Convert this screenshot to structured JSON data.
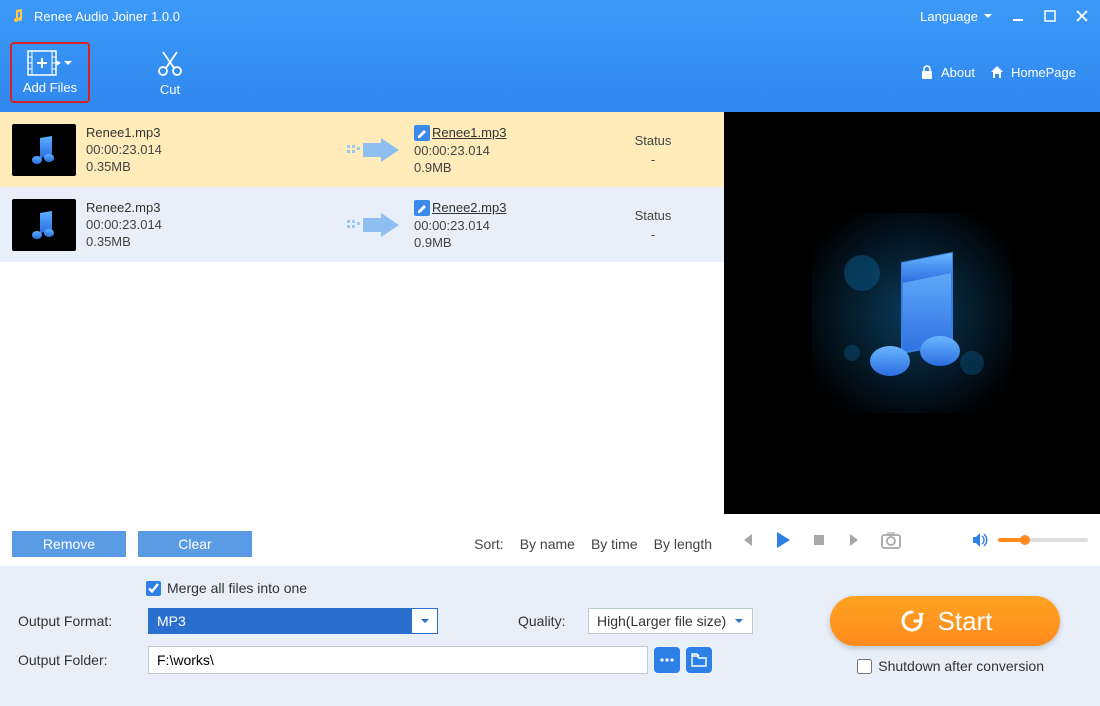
{
  "titlebar": {
    "title": "Renee Audio Joiner 1.0.0",
    "language_label": "Language"
  },
  "toolbar": {
    "add_files": "Add Files",
    "cut": "Cut",
    "about": "About",
    "homepage": "HomePage"
  },
  "files": [
    {
      "name": "Renee1.mp3",
      "duration": "00:00:23.014",
      "size": "0.35MB",
      "out_name": "Renee1.mp3",
      "out_duration": "00:00:23.014",
      "out_size": "0.9MB",
      "status_label": "Status",
      "status_value": "-",
      "selected": true
    },
    {
      "name": "Renee2.mp3",
      "duration": "00:00:23.014",
      "size": "0.35MB",
      "out_name": "Renee2.mp3",
      "out_duration": "00:00:23.014",
      "out_size": "0.9MB",
      "status_label": "Status",
      "status_value": "-",
      "selected": false
    }
  ],
  "listctrl": {
    "remove": "Remove",
    "clear": "Clear",
    "sort_label": "Sort:",
    "by_name": "By name",
    "by_time": "By time",
    "by_length": "By length"
  },
  "bottom": {
    "merge_label": "Merge all files into one",
    "merge_checked": true,
    "output_format_label": "Output Format:",
    "output_format_value": "MP3",
    "quality_label": "Quality:",
    "quality_value": "High(Larger file size)",
    "output_folder_label": "Output Folder:",
    "output_folder_value": "F:\\works\\",
    "start_label": "Start",
    "shutdown_label": "Shutdown after conversion",
    "shutdown_checked": false
  }
}
